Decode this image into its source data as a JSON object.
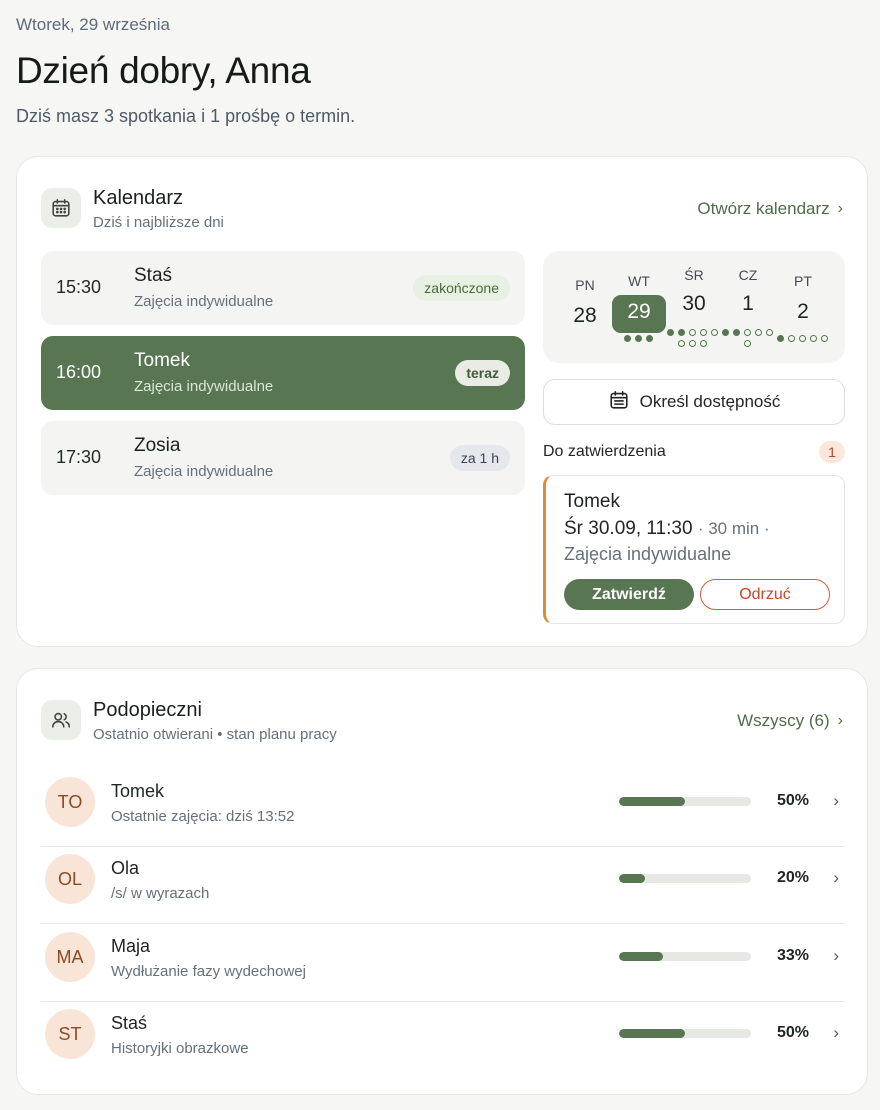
{
  "header": {
    "date": "Wtorek, 29 września",
    "greeting": "Dzień dobry, Anna",
    "summary": "Dziś masz 3 spotkania i 1 prośbę o termin."
  },
  "calendar": {
    "title": "Kalendarz",
    "subtitle": "Dziś i najbliższe dni",
    "open_link": "Otwórz kalendarz",
    "appointments": [
      {
        "time": "15:30",
        "name": "Staś",
        "kind": "Zajęcia indywidualne",
        "status": "zakończone"
      },
      {
        "time": "16:00",
        "name": "Tomek",
        "kind": "Zajęcia indywidualne",
        "status": "teraz"
      },
      {
        "time": "17:30",
        "name": "Zosia",
        "kind": "Zajęcia indywidualne",
        "status": "za 1 h"
      }
    ],
    "week": [
      {
        "name": "PN",
        "date": "28"
      },
      {
        "name": "WT",
        "date": "29"
      },
      {
        "name": "ŚR",
        "date": "30"
      },
      {
        "name": "CZ",
        "date": "1"
      },
      {
        "name": "PT",
        "date": "2"
      }
    ],
    "availability_button": "Określ dostępność",
    "pending": {
      "title": "Do zatwierdzenia",
      "count": "1",
      "request": {
        "name": "Tomek",
        "datetime": "Śr 30.09, 11:30",
        "duration": "· 30 min ·",
        "kind": "Zajęcia indywidualne",
        "approve": "Zatwierdź",
        "reject": "Odrzuć"
      }
    }
  },
  "clients": {
    "title": "Podopieczni",
    "subtitle": "Ostatnio otwierani • stan planu pracy",
    "all_link": "Wszyscy (6)",
    "items": [
      {
        "initials": "TO",
        "name": "Tomek",
        "status": "Ostatnie zajęcia: dziś 13:52",
        "progress": 50,
        "progress_label": "50%"
      },
      {
        "initials": "OL",
        "name": "Ola",
        "status": "/s/ w wyrazach",
        "progress": 20,
        "progress_label": "20%"
      },
      {
        "initials": "MA",
        "name": "Maja",
        "status": "Wydłużanie fazy wydechowej",
        "progress": 33,
        "progress_label": "33%"
      },
      {
        "initials": "ST",
        "name": "Staś",
        "status": "Historyjki obrazkowe",
        "progress": 50,
        "progress_label": "50%"
      }
    ]
  },
  "icons": {
    "calendar_card": "calendar-icon",
    "availability": "calendar-icon",
    "clients_card": "users-icon",
    "link": "chevron-right-icon"
  },
  "colors": {
    "accent": "#587651",
    "pending_border": "#e08a3c",
    "reject": "#c9452b",
    "avatar_bg": "#f8e5d8"
  }
}
